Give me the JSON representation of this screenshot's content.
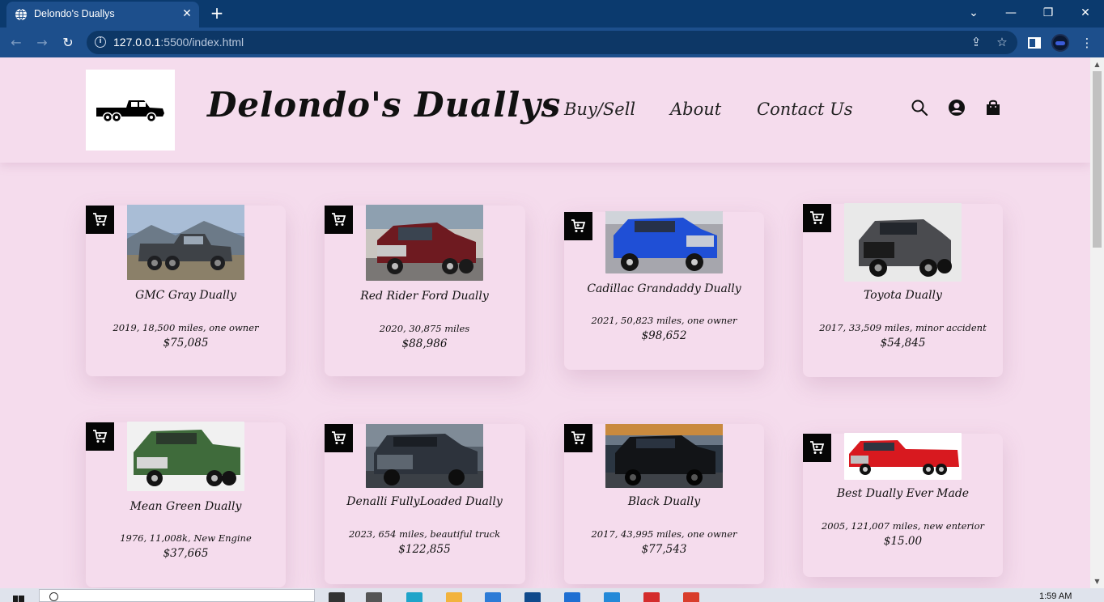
{
  "browser": {
    "tab_title": "Delondo's Duallys",
    "url_host": "127.0.0.1",
    "url_path": ":5500/index.html",
    "new_tab_symbol": "+",
    "close_symbol": "✕",
    "icons": [
      "globe-favicon-icon",
      "back-arrow-icon",
      "forward-arrow-icon",
      "reload-icon",
      "info-icon",
      "share-icon",
      "star-icon",
      "sidebar-icon",
      "profile-avatar",
      "kebab-menu-icon",
      "tab-search-icon",
      "minimize-icon",
      "restore-icon",
      "close-window-icon"
    ]
  },
  "site": {
    "title": "Delondo's Duallys",
    "logo_icon": "pickup-truck-icon",
    "nav": [
      "Buy/Sell",
      "About",
      "Contact Us"
    ],
    "header_icons": [
      "search-icon",
      "account-icon",
      "shopping-bag-icon"
    ],
    "accent_colors": {
      "background": "#f5dced",
      "cart_button": "#050505",
      "text": "#111111"
    }
  },
  "cars": [
    {
      "name": "GMC Gray Dually",
      "desc": "2019, 18,500 miles, one owner",
      "price": "$75,085",
      "image": "gray-dually-photo"
    },
    {
      "name": "Red Rider Ford Dually",
      "desc": "2020, 30,875 miles",
      "price": "$88,986",
      "image": "red-ford-dually-photo"
    },
    {
      "name": "Cadillac Grandaddy Dually",
      "desc": "2021, 50,823 miles, one owner",
      "price": "$98,652",
      "image": "blue-cadillac-dually-photo"
    },
    {
      "name": "Toyota Dually",
      "desc": "2017, 33,509 miles, minor accident",
      "price": "$54,845",
      "image": "gray-toyota-dually-photo"
    },
    {
      "name": "Mean Green Dually",
      "desc": "1976, 11,008k, New Engine",
      "price": "$37,665",
      "image": "green-dually-photo"
    },
    {
      "name": "Denalli FullyLoaded Dually",
      "desc": "2023, 654 miles, beautiful truck",
      "price": "$122,855",
      "image": "denali-dually-photo"
    },
    {
      "name": "Black Dually",
      "desc": "2017, 43,995 miles, one owner",
      "price": "$77,543",
      "image": "black-dually-photo"
    },
    {
      "name": "Best Dually Ever Made",
      "desc": "2005, 121,007 miles, new enterior",
      "price": "$15.00",
      "image": "red-dually-photo"
    }
  ],
  "taskbar": {
    "time": "1:59 AM"
  }
}
